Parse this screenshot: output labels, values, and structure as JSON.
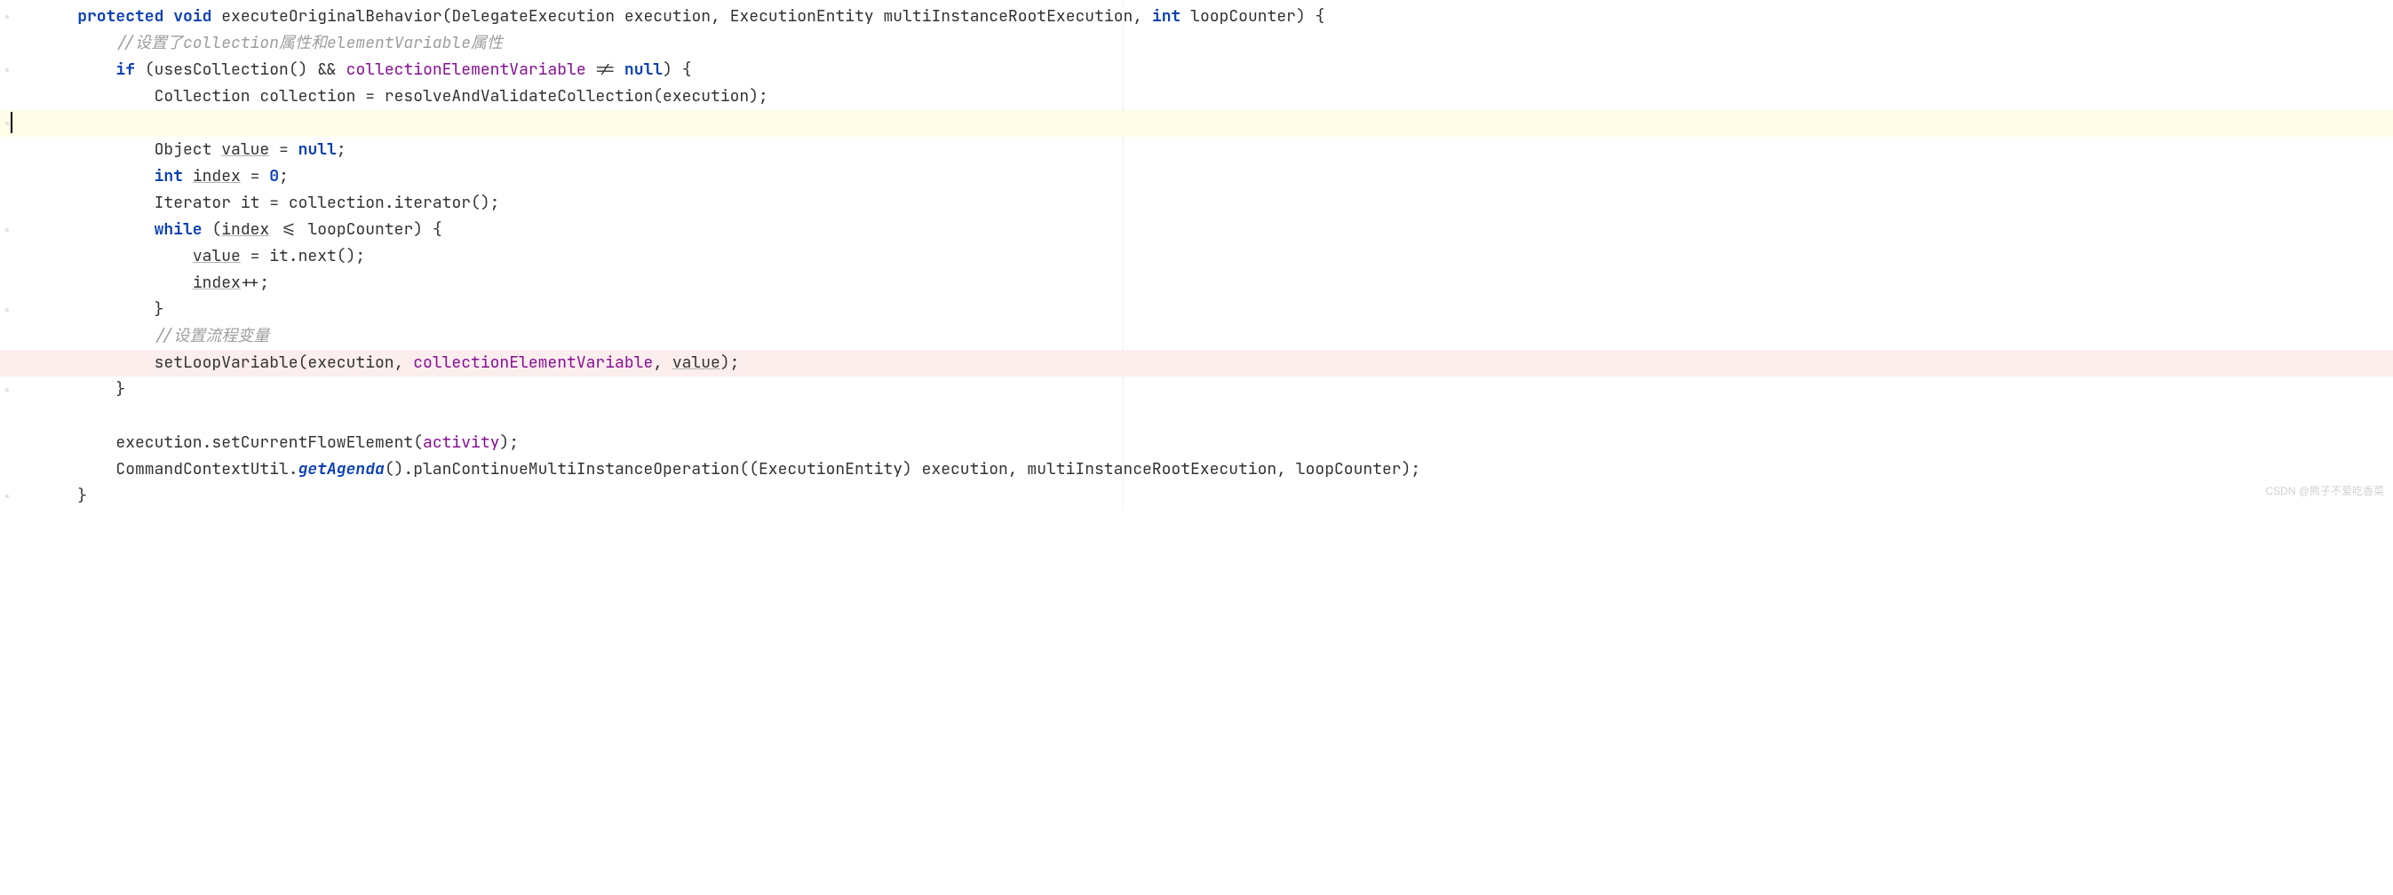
{
  "code": {
    "l1": {
      "k_protected": "protected",
      "k_void": "void",
      "method": "executeOriginalBehavior",
      "param1_type": "DelegateExecution",
      "param1_name": "execution",
      "param2_type": "ExecutionEntity",
      "param2_name": "multiInstanceRootExecution",
      "param3_type": "int",
      "param3_name": "loopCounter",
      "brace": ") {"
    },
    "l2": {
      "comment": "//设置了collection属性和elementVariable属性"
    },
    "l3": {
      "k_if": "if",
      "call": "usesCollection()",
      "op": "&&",
      "field": "collectionElementVariable",
      "neq": "!=",
      "k_null": "null",
      "brace": ") {"
    },
    "l4": {
      "type": "Collection",
      "name": "collection",
      "assign": "= resolveAndValidateCollection(execution);"
    },
    "l6": {
      "type": "Object",
      "name": "value",
      "eq": "=",
      "k_null": "null",
      "semi": ";"
    },
    "l7": {
      "k_int": "int",
      "name": "index",
      "eq": "=",
      "zero": "0",
      "semi": ";"
    },
    "l8": {
      "type": "Iterator",
      "name": "it",
      "rest": "= collection.iterator();"
    },
    "l9": {
      "k_while": "while",
      "open": "(",
      "var": "index",
      "op": "<= loopCounter) {"
    },
    "l10": {
      "var": "value",
      "rest": " = it.next();"
    },
    "l11": {
      "var": "index",
      "rest": "++;"
    },
    "l12": {
      "brace": "}"
    },
    "l13": {
      "comment": "//设置流程变量"
    },
    "l14": {
      "call": "setLoopVariable(execution, ",
      "field": "collectionElementVariable",
      "mid": ", ",
      "var": "value",
      "end": ");"
    },
    "l15": {
      "brace": "}"
    },
    "l17": {
      "text": "execution.setCurrentFlowElement(",
      "field": "activity",
      "end": ");"
    },
    "l18": {
      "cls": "CommandContextUtil.",
      "method": "getAgenda",
      "rest": "().planContinueMultiInstanceOperation((ExecutionEntity) execution, multiInstanceRootExecution, loopCounter);"
    },
    "l19": {
      "brace": "}"
    }
  },
  "watermark": "CSDN @熊子不爱吃香菜"
}
